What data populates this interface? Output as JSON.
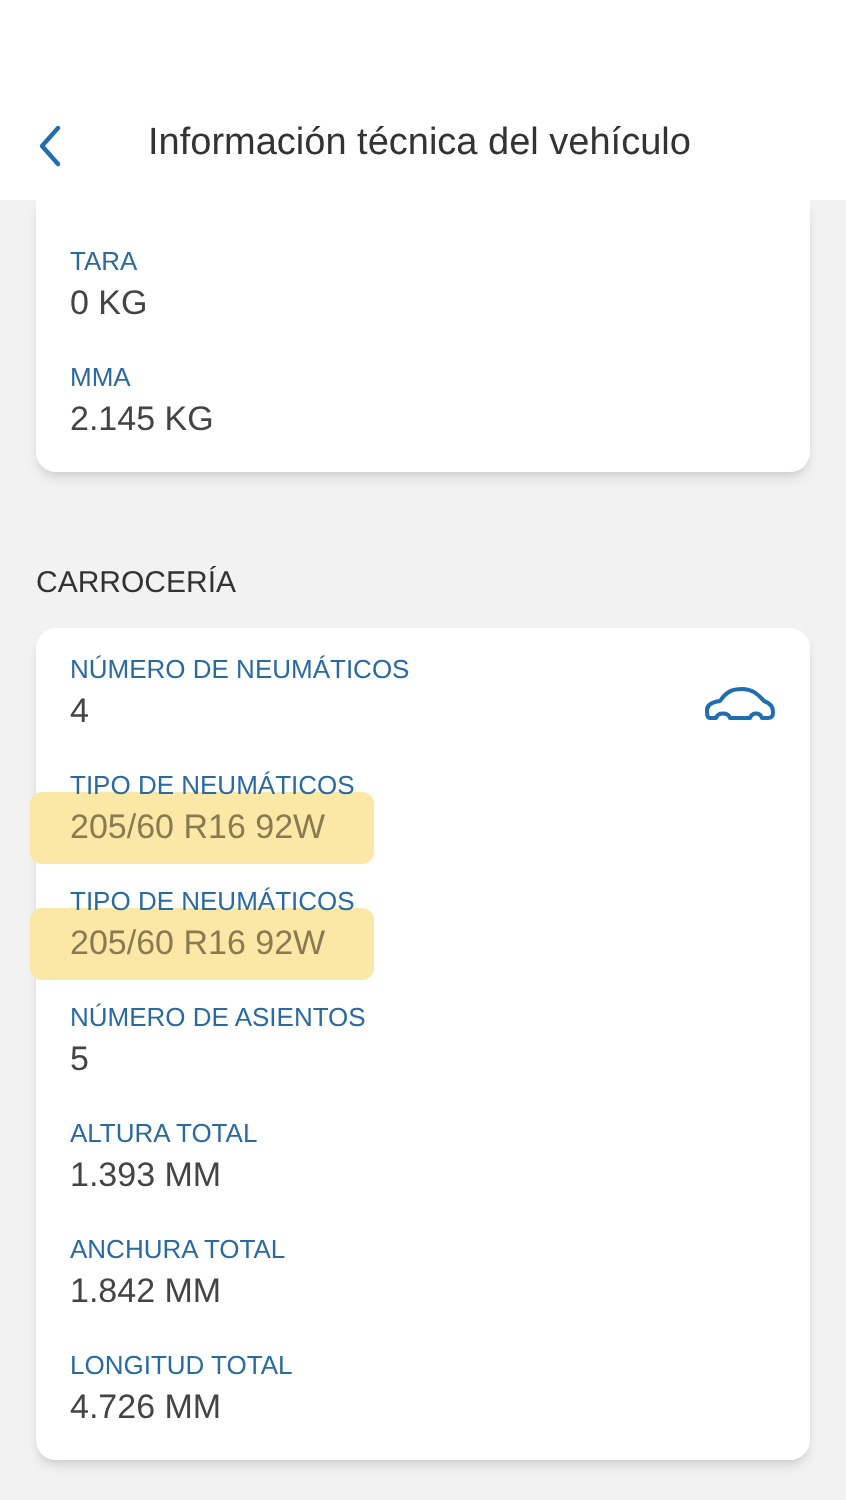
{
  "header": {
    "title": "Información técnica del vehículo"
  },
  "cards": [
    {
      "fields": [
        {
          "label": "TARA",
          "value": "0 KG",
          "highlighted": false
        },
        {
          "label": "MMA",
          "value": "2.145 KG",
          "highlighted": false
        }
      ]
    },
    {
      "heading": "CARROCERÍA",
      "fields": [
        {
          "label": "NÚMERO DE NEUMÁTICOS",
          "value": "4",
          "highlighted": false
        },
        {
          "label": "TIPO DE NEUMÁTICOS",
          "value": "205/60 R16 92W",
          "highlighted": true
        },
        {
          "label": "TIPO DE NEUMÁTICOS",
          "value": "205/60 R16 92W",
          "highlighted": true
        },
        {
          "label": "NÚMERO DE ASIENTOS",
          "value": "5",
          "highlighted": false
        },
        {
          "label": "ALTURA TOTAL",
          "value": "1.393 MM",
          "highlighted": false
        },
        {
          "label": "ANCHURA TOTAL",
          "value": "1.842 MM",
          "highlighted": false
        },
        {
          "label": "LONGITUD TOTAL",
          "value": "4.726 MM",
          "highlighted": false
        }
      ]
    }
  ]
}
